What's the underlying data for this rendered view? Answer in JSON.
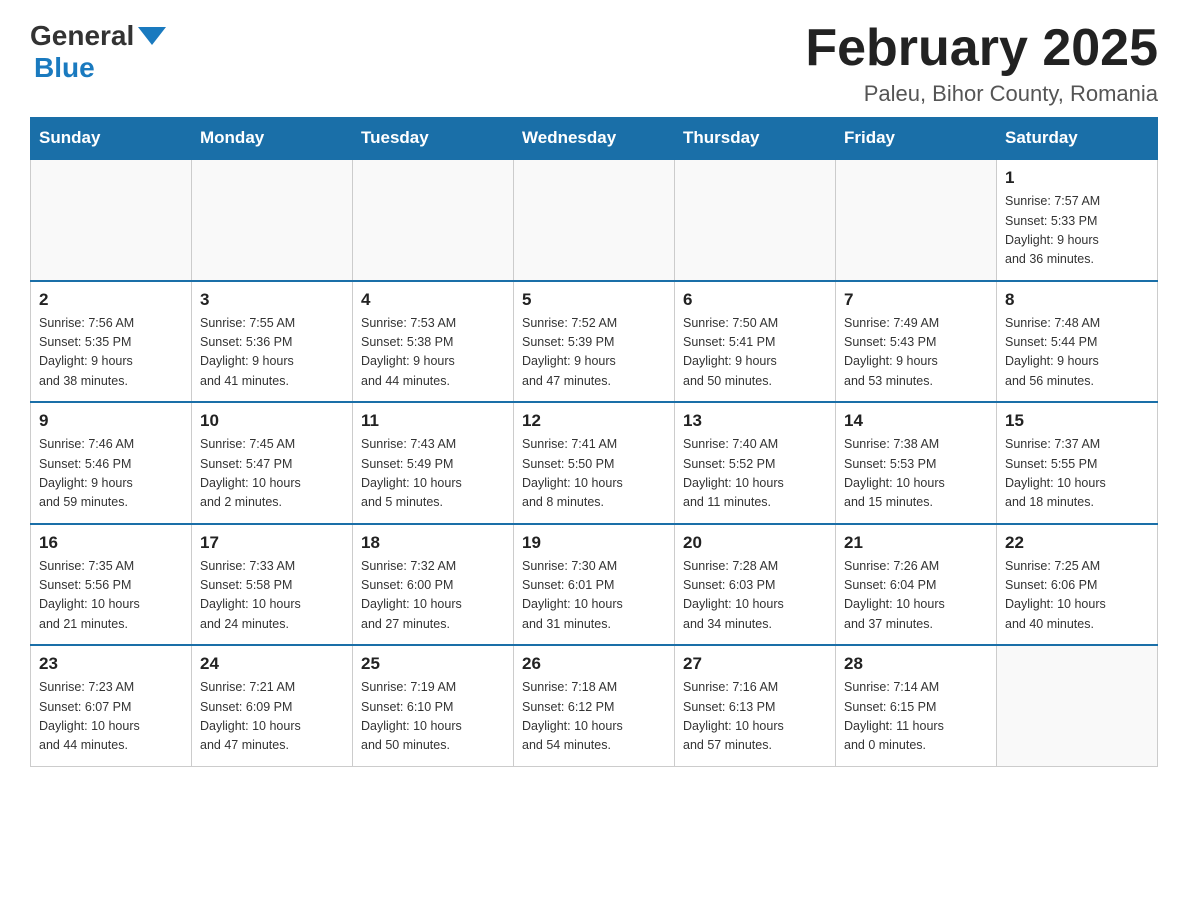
{
  "header": {
    "logo": {
      "general": "General",
      "blue": "Blue"
    },
    "title": "February 2025",
    "location": "Paleu, Bihor County, Romania"
  },
  "days_header": [
    "Sunday",
    "Monday",
    "Tuesday",
    "Wednesday",
    "Thursday",
    "Friday",
    "Saturday"
  ],
  "weeks": [
    {
      "days": [
        {
          "number": "",
          "info": ""
        },
        {
          "number": "",
          "info": ""
        },
        {
          "number": "",
          "info": ""
        },
        {
          "number": "",
          "info": ""
        },
        {
          "number": "",
          "info": ""
        },
        {
          "number": "",
          "info": ""
        },
        {
          "number": "1",
          "info": "Sunrise: 7:57 AM\nSunset: 5:33 PM\nDaylight: 9 hours\nand 36 minutes."
        }
      ]
    },
    {
      "days": [
        {
          "number": "2",
          "info": "Sunrise: 7:56 AM\nSunset: 5:35 PM\nDaylight: 9 hours\nand 38 minutes."
        },
        {
          "number": "3",
          "info": "Sunrise: 7:55 AM\nSunset: 5:36 PM\nDaylight: 9 hours\nand 41 minutes."
        },
        {
          "number": "4",
          "info": "Sunrise: 7:53 AM\nSunset: 5:38 PM\nDaylight: 9 hours\nand 44 minutes."
        },
        {
          "number": "5",
          "info": "Sunrise: 7:52 AM\nSunset: 5:39 PM\nDaylight: 9 hours\nand 47 minutes."
        },
        {
          "number": "6",
          "info": "Sunrise: 7:50 AM\nSunset: 5:41 PM\nDaylight: 9 hours\nand 50 minutes."
        },
        {
          "number": "7",
          "info": "Sunrise: 7:49 AM\nSunset: 5:43 PM\nDaylight: 9 hours\nand 53 minutes."
        },
        {
          "number": "8",
          "info": "Sunrise: 7:48 AM\nSunset: 5:44 PM\nDaylight: 9 hours\nand 56 minutes."
        }
      ]
    },
    {
      "days": [
        {
          "number": "9",
          "info": "Sunrise: 7:46 AM\nSunset: 5:46 PM\nDaylight: 9 hours\nand 59 minutes."
        },
        {
          "number": "10",
          "info": "Sunrise: 7:45 AM\nSunset: 5:47 PM\nDaylight: 10 hours\nand 2 minutes."
        },
        {
          "number": "11",
          "info": "Sunrise: 7:43 AM\nSunset: 5:49 PM\nDaylight: 10 hours\nand 5 minutes."
        },
        {
          "number": "12",
          "info": "Sunrise: 7:41 AM\nSunset: 5:50 PM\nDaylight: 10 hours\nand 8 minutes."
        },
        {
          "number": "13",
          "info": "Sunrise: 7:40 AM\nSunset: 5:52 PM\nDaylight: 10 hours\nand 11 minutes."
        },
        {
          "number": "14",
          "info": "Sunrise: 7:38 AM\nSunset: 5:53 PM\nDaylight: 10 hours\nand 15 minutes."
        },
        {
          "number": "15",
          "info": "Sunrise: 7:37 AM\nSunset: 5:55 PM\nDaylight: 10 hours\nand 18 minutes."
        }
      ]
    },
    {
      "days": [
        {
          "number": "16",
          "info": "Sunrise: 7:35 AM\nSunset: 5:56 PM\nDaylight: 10 hours\nand 21 minutes."
        },
        {
          "number": "17",
          "info": "Sunrise: 7:33 AM\nSunset: 5:58 PM\nDaylight: 10 hours\nand 24 minutes."
        },
        {
          "number": "18",
          "info": "Sunrise: 7:32 AM\nSunset: 6:00 PM\nDaylight: 10 hours\nand 27 minutes."
        },
        {
          "number": "19",
          "info": "Sunrise: 7:30 AM\nSunset: 6:01 PM\nDaylight: 10 hours\nand 31 minutes."
        },
        {
          "number": "20",
          "info": "Sunrise: 7:28 AM\nSunset: 6:03 PM\nDaylight: 10 hours\nand 34 minutes."
        },
        {
          "number": "21",
          "info": "Sunrise: 7:26 AM\nSunset: 6:04 PM\nDaylight: 10 hours\nand 37 minutes."
        },
        {
          "number": "22",
          "info": "Sunrise: 7:25 AM\nSunset: 6:06 PM\nDaylight: 10 hours\nand 40 minutes."
        }
      ]
    },
    {
      "days": [
        {
          "number": "23",
          "info": "Sunrise: 7:23 AM\nSunset: 6:07 PM\nDaylight: 10 hours\nand 44 minutes."
        },
        {
          "number": "24",
          "info": "Sunrise: 7:21 AM\nSunset: 6:09 PM\nDaylight: 10 hours\nand 47 minutes."
        },
        {
          "number": "25",
          "info": "Sunrise: 7:19 AM\nSunset: 6:10 PM\nDaylight: 10 hours\nand 50 minutes."
        },
        {
          "number": "26",
          "info": "Sunrise: 7:18 AM\nSunset: 6:12 PM\nDaylight: 10 hours\nand 54 minutes."
        },
        {
          "number": "27",
          "info": "Sunrise: 7:16 AM\nSunset: 6:13 PM\nDaylight: 10 hours\nand 57 minutes."
        },
        {
          "number": "28",
          "info": "Sunrise: 7:14 AM\nSunset: 6:15 PM\nDaylight: 11 hours\nand 0 minutes."
        },
        {
          "number": "",
          "info": ""
        }
      ]
    }
  ]
}
